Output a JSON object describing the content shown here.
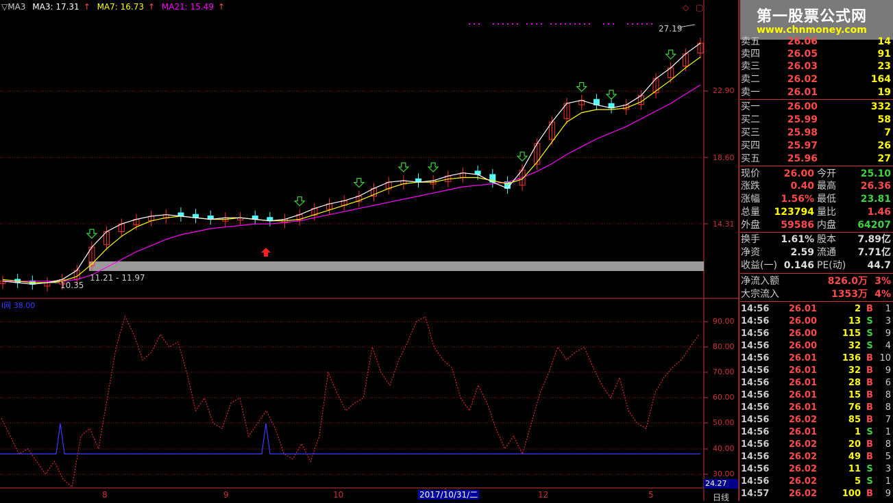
{
  "main_chart": {
    "legend": {
      "prefix": "▽MA3",
      "ma3": "MA3: 17.31",
      "ma7": "MA7: 16.73",
      "ma21": "MA21: 15.49",
      "ma3_color": "#ffffff",
      "ma7_color": "#ffff00",
      "ma21_color": "#ff00ff"
    },
    "y_axis_labels": [
      "22.90",
      "18.60",
      "14.31"
    ],
    "high_annotation": "27.19",
    "low_annotation": "10.35",
    "range_annotation": "11.21 - 11.97",
    "corner_icons": [
      "◇",
      "▢"
    ]
  },
  "indicator": {
    "legend": "I网 38.00",
    "y_axis_labels": [
      "90.00",
      "80.00",
      "70.00",
      "60.00",
      "50.00",
      "40.00",
      "30.00"
    ],
    "current_value": "24.27"
  },
  "x_axis": {
    "ticks": [
      "8",
      "9",
      "10",
      "12",
      "5"
    ],
    "selected_date": "2017/10/31/二",
    "period": "日线"
  },
  "chart_data": {
    "type": "line",
    "title": "",
    "price": {
      "ma3": [
        10.6,
        10.5,
        10.4,
        10.5,
        10.7,
        11.3,
        12.8,
        13.8,
        14.3,
        14.6,
        14.8,
        14.9,
        14.8,
        14.7,
        14.6,
        14.7,
        14.7,
        14.6,
        14.5,
        14.6,
        14.9,
        15.3,
        15.6,
        15.8,
        16.1,
        16.6,
        17.0,
        17.1,
        17.0,
        17.1,
        17.4,
        17.6,
        17.5,
        17.0,
        16.6,
        17.8,
        19.5,
        20.9,
        22.1,
        22.3,
        22.0,
        21.8,
        22.0,
        22.6,
        23.7,
        24.4,
        25.3,
        26.0
      ],
      "ma7": [
        10.7,
        10.6,
        10.5,
        10.5,
        10.6,
        10.9,
        11.7,
        12.7,
        13.5,
        14.1,
        14.5,
        14.7,
        14.8,
        14.7,
        14.6,
        14.6,
        14.7,
        14.6,
        14.5,
        14.5,
        14.6,
        14.9,
        15.2,
        15.5,
        15.8,
        16.2,
        16.6,
        16.9,
        17.0,
        17.0,
        17.2,
        17.3,
        17.3,
        17.1,
        16.9,
        17.2,
        18.3,
        19.6,
        20.9,
        21.5,
        21.7,
        21.7,
        21.8,
        22.2,
        22.9,
        23.6,
        24.4,
        25.1
      ],
      "ma21": [
        10.6,
        10.6,
        10.6,
        10.6,
        10.6,
        10.7,
        11.0,
        11.5,
        12.0,
        12.5,
        12.9,
        13.3,
        13.6,
        13.8,
        14.0,
        14.1,
        14.2,
        14.3,
        14.3,
        14.4,
        14.5,
        14.7,
        14.9,
        15.1,
        15.3,
        15.5,
        15.7,
        15.9,
        16.1,
        16.3,
        16.5,
        16.7,
        16.8,
        16.9,
        17.0,
        17.3,
        17.7,
        18.2,
        18.8,
        19.3,
        19.8,
        20.2,
        20.6,
        21.1,
        21.6,
        22.1,
        22.7,
        23.3
      ]
    },
    "indicator_series": [
      52,
      45,
      38,
      40,
      35,
      30,
      35,
      28,
      25,
      45,
      48,
      40,
      60,
      80,
      92,
      85,
      75,
      78,
      85,
      80,
      82,
      70,
      55,
      60,
      50,
      48,
      58,
      60,
      45,
      50,
      55,
      48,
      38,
      36,
      42,
      35,
      45,
      70,
      62,
      55,
      58,
      60,
      80,
      70,
      65,
      75,
      82,
      90,
      92,
      80,
      75,
      72,
      60,
      55,
      65,
      58,
      48,
      40,
      45,
      38,
      50,
      62,
      70,
      80,
      75,
      78,
      80,
      72,
      65,
      60,
      68,
      55,
      50,
      48,
      62,
      68,
      72,
      75,
      80,
      85
    ]
  },
  "panel": {
    "logo_title": "第一股票公式网",
    "logo_url": "www.chnmoney.com",
    "asks": [
      {
        "label": "卖五",
        "price": "26.06",
        "vol": "14"
      },
      {
        "label": "卖四",
        "price": "26.05",
        "vol": "91"
      },
      {
        "label": "卖三",
        "price": "26.03",
        "vol": "23"
      },
      {
        "label": "卖二",
        "price": "26.02",
        "vol": "164"
      },
      {
        "label": "卖一",
        "price": "26.01",
        "vol": "19"
      }
    ],
    "bids": [
      {
        "label": "买一",
        "price": "26.00",
        "vol": "332"
      },
      {
        "label": "买二",
        "price": "25.99",
        "vol": "58"
      },
      {
        "label": "买三",
        "price": "25.98",
        "vol": "7"
      },
      {
        "label": "买四",
        "price": "25.97",
        "vol": "26"
      },
      {
        "label": "买五",
        "price": "25.96",
        "vol": "27"
      }
    ],
    "quote": [
      {
        "l1": "现价",
        "v1": "26.00",
        "c1": "red",
        "l2": "今开",
        "v2": "25.10",
        "c2": "green"
      },
      {
        "l1": "涨跌",
        "v1": "0.40",
        "c1": "red",
        "l2": "最高",
        "v2": "26.36",
        "c2": "red"
      },
      {
        "l1": "涨幅",
        "v1": "1.56%",
        "c1": "red",
        "l2": "最低",
        "v2": "23.81",
        "c2": "green"
      },
      {
        "l1": "总量",
        "v1": "123794",
        "c1": "yellow",
        "l2": "量比",
        "v2": "1.46",
        "c2": "red"
      },
      {
        "l1": "外盘",
        "v1": "59586",
        "c1": "red",
        "l2": "内盘",
        "v2": "64207",
        "c2": "green"
      }
    ],
    "stats": [
      {
        "l1": "换手",
        "v1": "1.61%",
        "c1": "white",
        "l2": "股本",
        "v2": "7.89亿",
        "c2": "white"
      },
      {
        "l1": "净资",
        "v1": "2.59",
        "c1": "white",
        "l2": "流通",
        "v2": "7.71亿",
        "c2": "white"
      },
      {
        "l1": "收益(一)",
        "v1": "0.146",
        "c1": "white",
        "l2": "PE(动)",
        "v2": "44.7",
        "c2": "white"
      }
    ],
    "flows": [
      {
        "label": "净流入额",
        "value": "826.0万",
        "pct": "3%"
      },
      {
        "label": "大宗流入",
        "value": "1353万",
        "pct": "4%"
      }
    ],
    "ticks": [
      {
        "time": "14:56",
        "price": "26.01",
        "pc": "red",
        "vol": "2",
        "side": "B",
        "sc": "red",
        "n": "1"
      },
      {
        "time": "14:56",
        "price": "26.00",
        "pc": "red",
        "vol": "13",
        "side": "S",
        "sc": "green",
        "n": "3"
      },
      {
        "time": "14:56",
        "price": "26.00",
        "pc": "red",
        "vol": "115",
        "side": "S",
        "sc": "green",
        "n": "9"
      },
      {
        "time": "14:56",
        "price": "26.00",
        "pc": "red",
        "vol": "32",
        "side": "S",
        "sc": "green",
        "n": "4"
      },
      {
        "time": "14:56",
        "price": "26.01",
        "pc": "red",
        "vol": "136",
        "side": "B",
        "sc": "red",
        "n": "10"
      },
      {
        "time": "14:56",
        "price": "26.01",
        "pc": "red",
        "vol": "32",
        "side": "B",
        "sc": "red",
        "n": "9"
      },
      {
        "time": "14:56",
        "price": "26.01",
        "pc": "red",
        "vol": "28",
        "side": "B",
        "sc": "red",
        "n": "6"
      },
      {
        "time": "14:56",
        "price": "26.01",
        "pc": "red",
        "vol": "15",
        "side": "B",
        "sc": "red",
        "n": "8"
      },
      {
        "time": "14:56",
        "price": "26.01",
        "pc": "red",
        "vol": "76",
        "side": "B",
        "sc": "red",
        "n": "8"
      },
      {
        "time": "14:56",
        "price": "26.02",
        "pc": "red",
        "vol": "85",
        "side": "B",
        "sc": "red",
        "n": "7"
      },
      {
        "time": "14:56",
        "price": "26.01",
        "pc": "red",
        "vol": "1",
        "side": "S",
        "sc": "green",
        "n": "1"
      },
      {
        "time": "14:56",
        "price": "26.02",
        "pc": "red",
        "vol": "20",
        "side": "B",
        "sc": "red",
        "n": "8"
      },
      {
        "time": "14:56",
        "price": "26.02",
        "pc": "red",
        "vol": "49",
        "side": "B",
        "sc": "red",
        "n": "5"
      },
      {
        "time": "14:56",
        "price": "26.02",
        "pc": "red",
        "vol": "11",
        "side": "S",
        "sc": "green",
        "n": "3"
      },
      {
        "time": "14:56",
        "price": "26.02",
        "pc": "red",
        "vol": "5",
        "side": "S",
        "sc": "green",
        "n": "1"
      },
      {
        "time": "14:57",
        "price": "26.02",
        "pc": "red",
        "vol": "100",
        "side": "B",
        "sc": "red",
        "n": "9"
      }
    ]
  }
}
